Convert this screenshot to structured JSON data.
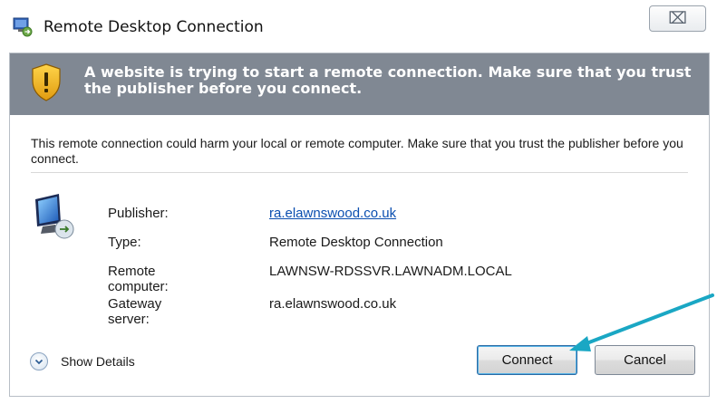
{
  "window": {
    "title": "Remote Desktop Connection",
    "close_label": "⌧"
  },
  "warning": {
    "text": "A website is trying to start a remote connection. Make sure that you trust the publisher before you connect."
  },
  "message": "This remote connection could harm your local or remote computer. Make sure that you trust the publisher before you connect.",
  "details": [
    {
      "label": "Publisher:",
      "value": "ra.elawnswood.co.uk"
    },
    {
      "label": "Type:",
      "value": "Remote Desktop Connection"
    },
    {
      "label": "Remote computer:",
      "value": "LAWNSW-RDSSVR.LAWNADM.LOCAL"
    },
    {
      "label": "Gateway server:",
      "value": "ra.elawnswood.co.uk"
    }
  ],
  "footer": {
    "show_details_label": "Show Details",
    "connect_label": "Connect",
    "cancel_label": "Cancel"
  },
  "colors": {
    "warning_bar": "#808893",
    "link": "#0b4fb0",
    "annotation_arrow": "#1aa7c4"
  }
}
